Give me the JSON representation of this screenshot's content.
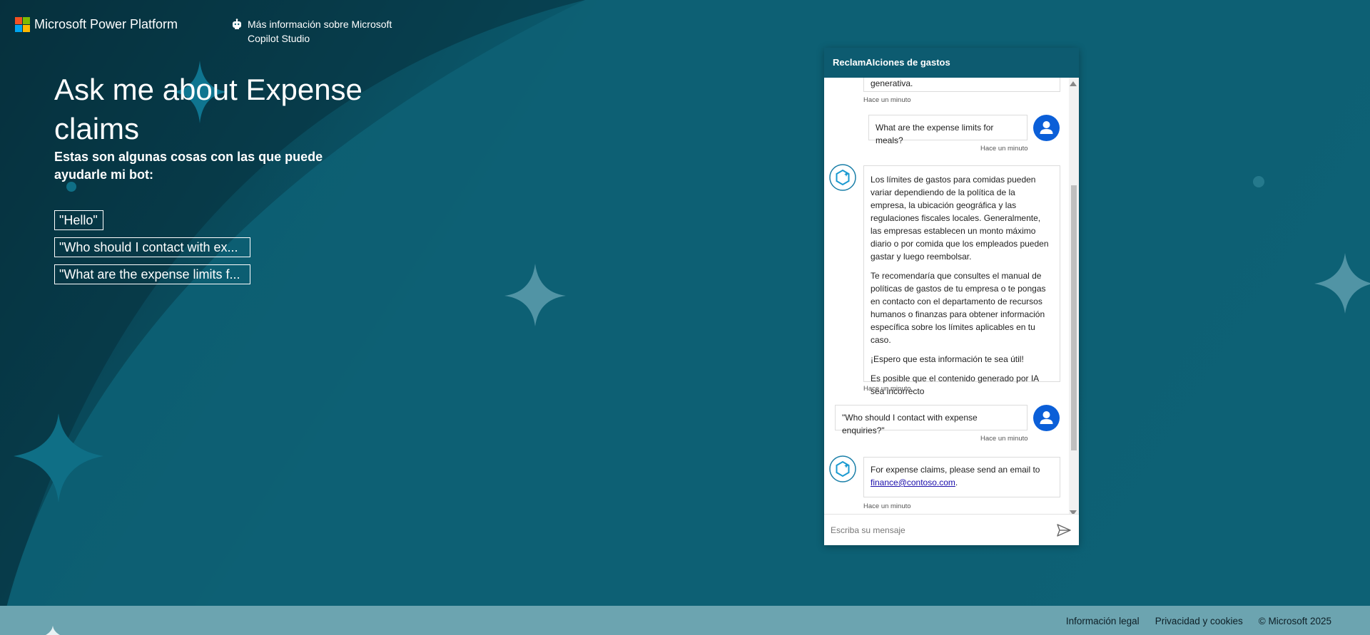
{
  "header": {
    "brand": "Microsoft Power Platform",
    "learn_more": "Más información sobre Microsoft Copilot Studio",
    "logo_colors": [
      "#f25022",
      "#7fba00",
      "#00a4ef",
      "#ffb900"
    ]
  },
  "hero": {
    "title": "Ask me about Expense claims",
    "subtitle": "Estas son algunas cosas con las que puede ayudarle mi bot:",
    "suggestions": [
      "\"Hello\"",
      "\"Who should I contact with ex...",
      "\"What are the expense limits f..."
    ]
  },
  "chat": {
    "title": "ReclamAIciones de gastos",
    "messages": [
      {
        "role": "bot",
        "partial_text": "generativa.",
        "timestamp": "Hace un minuto"
      },
      {
        "role": "user",
        "text": "What are the expense limits for meals?",
        "timestamp": "Hace un minuto"
      },
      {
        "role": "bot",
        "paragraphs": [
          "Los límites de gastos para comidas pueden variar dependiendo de la política de la empresa, la ubicación geográfica y las regulaciones fiscales locales. Generalmente, las empresas establecen un monto máximo diario o por comida que los empleados pueden gastar y luego reembolsar.",
          "Te recomendaría que consultes el manual de políticas de gastos de tu empresa o te pongas en contacto con el departamento de recursos humanos o finanzas para obtener información específica sobre los límites aplicables en tu caso.",
          "¡Espero que esta información te sea útil!",
          "Es posible que el contenido generado por IA sea incorrecto"
        ],
        "timestamp": "Hace un minuto"
      },
      {
        "role": "user",
        "text": "\"Who should I contact with expense enquiries?\"",
        "timestamp": "Hace un minuto"
      },
      {
        "role": "bot",
        "text_before": "For expense claims, please send an email to ",
        "link": "finance@contoso.com",
        "text_after": ".",
        "timestamp": "Hace un minuto"
      }
    ],
    "input_placeholder": "Escriba su mensaje"
  },
  "footer": {
    "legal": "Información legal",
    "privacy": "Privacidad y cookies",
    "copyright": "© Microsoft 2025"
  },
  "colors": {
    "background": "#0c5f73",
    "chat_header": "#0d5b70",
    "user_avatar": "#0b5fd8",
    "footer": "#6ca4b0"
  }
}
